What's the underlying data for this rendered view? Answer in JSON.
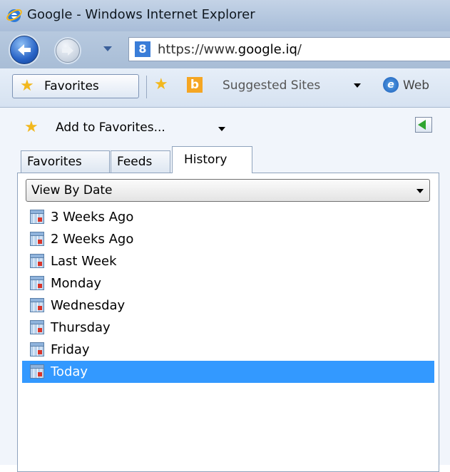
{
  "window": {
    "title": "Google - Windows Internet Explorer"
  },
  "nav": {
    "back_icon": "back-arrow-icon",
    "forward_icon": "forward-arrow-icon",
    "url_prefix": "https://www.",
    "url_domain": "google.iq",
    "url_suffix": "/"
  },
  "favorites_bar": {
    "favorites_label": "Favorites",
    "suggested_sites_label": "Suggested Sites",
    "web_label": "Web"
  },
  "panel": {
    "add_to_favorites_label": "Add to Favorites...",
    "tabs": [
      {
        "label": "Favorites"
      },
      {
        "label": "Feeds"
      },
      {
        "label": "History"
      }
    ],
    "active_tab": "History",
    "view_select": {
      "value": "View By Date"
    },
    "history_items": [
      {
        "label": "3 Weeks Ago"
      },
      {
        "label": "2 Weeks Ago"
      },
      {
        "label": "Last Week"
      },
      {
        "label": "Monday"
      },
      {
        "label": "Wednesday"
      },
      {
        "label": "Thursday"
      },
      {
        "label": "Friday"
      },
      {
        "label": "Today"
      }
    ],
    "selected_item": "Today"
  },
  "colors": {
    "selection": "#3399ff",
    "titlebar": "#b3c6de"
  }
}
